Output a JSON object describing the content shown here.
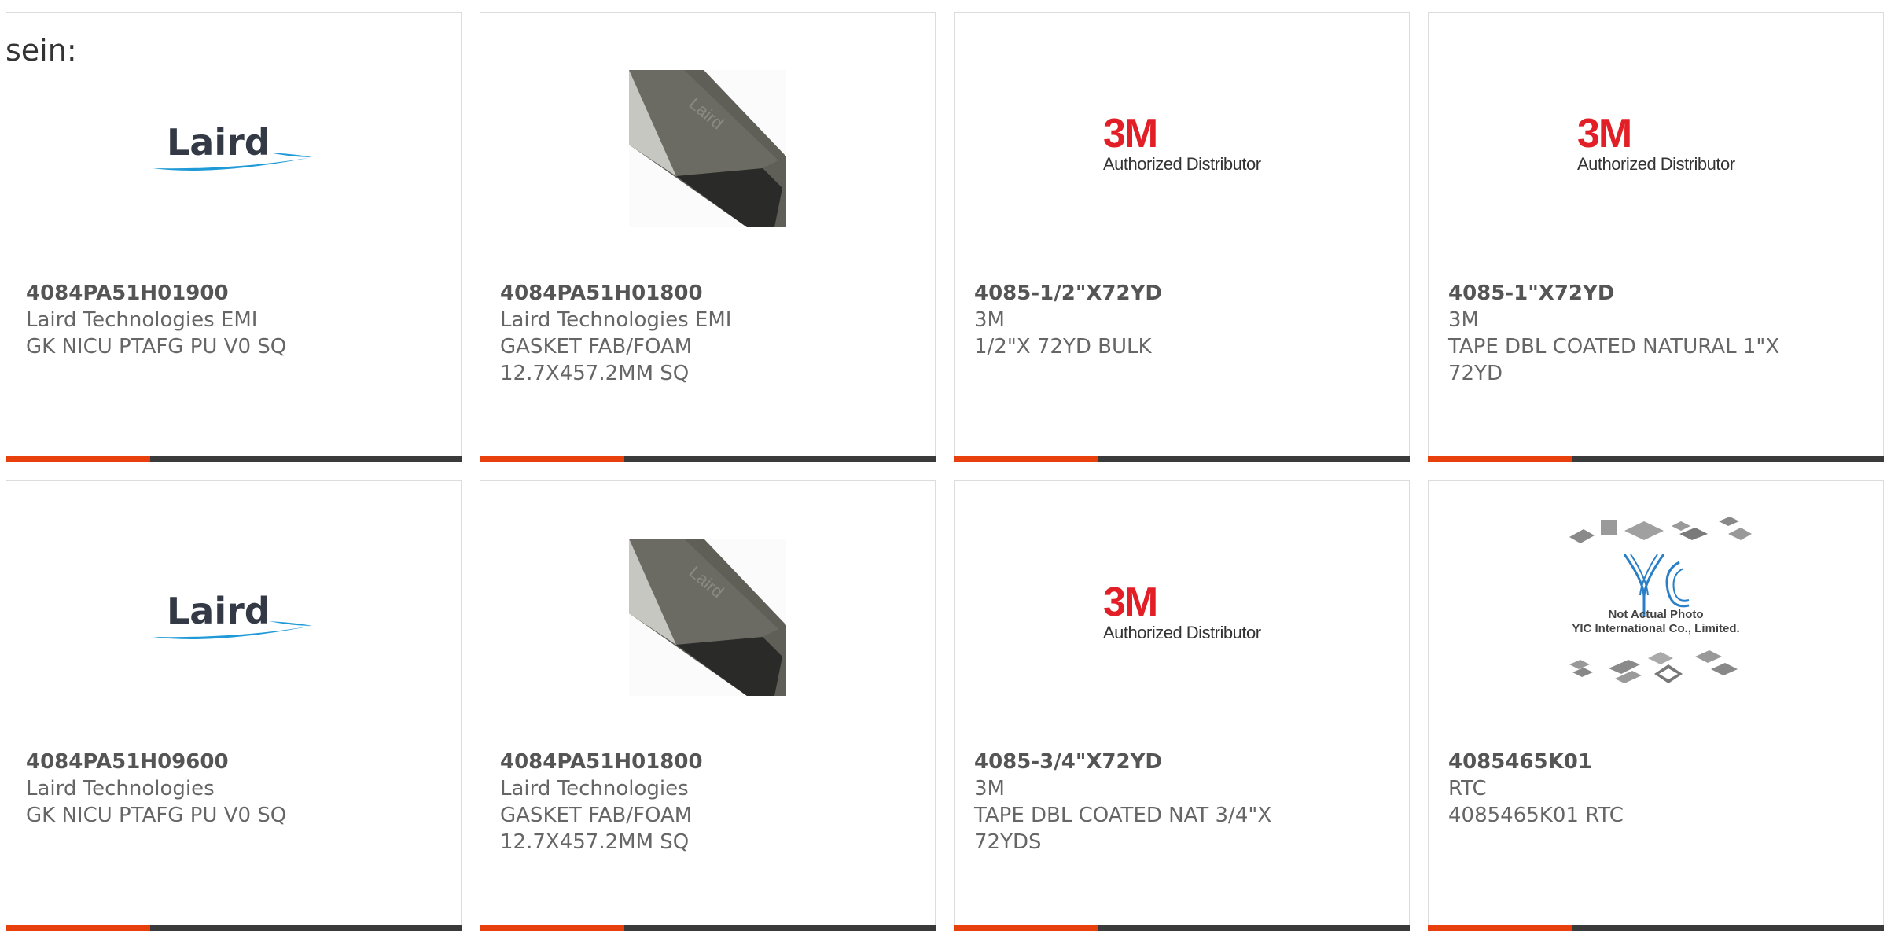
{
  "lead_text": "sein:",
  "colors": {
    "accent": "#e8400c",
    "bar": "#3a3a3a",
    "text": "#666666"
  },
  "brands": {
    "laird": {
      "logo_text": "Laird"
    },
    "threem": {
      "logo_text": "3M",
      "sub": "Authorized Distributor"
    },
    "yic": {
      "line1": "Not Actual Photo",
      "line2": "YIC International Co., Limited."
    }
  },
  "products": [
    {
      "part": "4084PA51H01900",
      "maker": "Laird Technologies EMI",
      "desc": "GK NICU PTAFG PU V0 SQ",
      "image": "laird-logo"
    },
    {
      "part": "4084PA51H01800",
      "maker": "Laird Technologies EMI",
      "desc": "GASKET FAB/FOAM 12.7X457.2MM SQ",
      "image": "gasket-photo"
    },
    {
      "part": "4085-1/2\"X72YD",
      "maker": "3M",
      "desc": "1/2\"X 72YD BULK",
      "image": "3m-logo"
    },
    {
      "part": "4085-1\"X72YD",
      "maker": "3M",
      "desc": "TAPE DBL COATED NATURAL 1\"X 72YD",
      "image": "3m-logo"
    },
    {
      "part": "4084PA51H09600",
      "maker": "Laird Technologies",
      "desc": "GK NICU PTAFG PU V0 SQ",
      "image": "laird-logo"
    },
    {
      "part": "4084PA51H01800",
      "maker": "Laird Technologies",
      "desc": "GASKET FAB/FOAM 12.7X457.2MM SQ",
      "image": "gasket-photo"
    },
    {
      "part": "4085-3/4\"X72YD",
      "maker": "3M",
      "desc": "TAPE DBL COATED NAT 3/4\"X 72YDS",
      "image": "3m-logo"
    },
    {
      "part": "4085465K01",
      "maker": "RTC",
      "desc": "4085465K01 RTC",
      "image": "yic-placeholder"
    }
  ]
}
